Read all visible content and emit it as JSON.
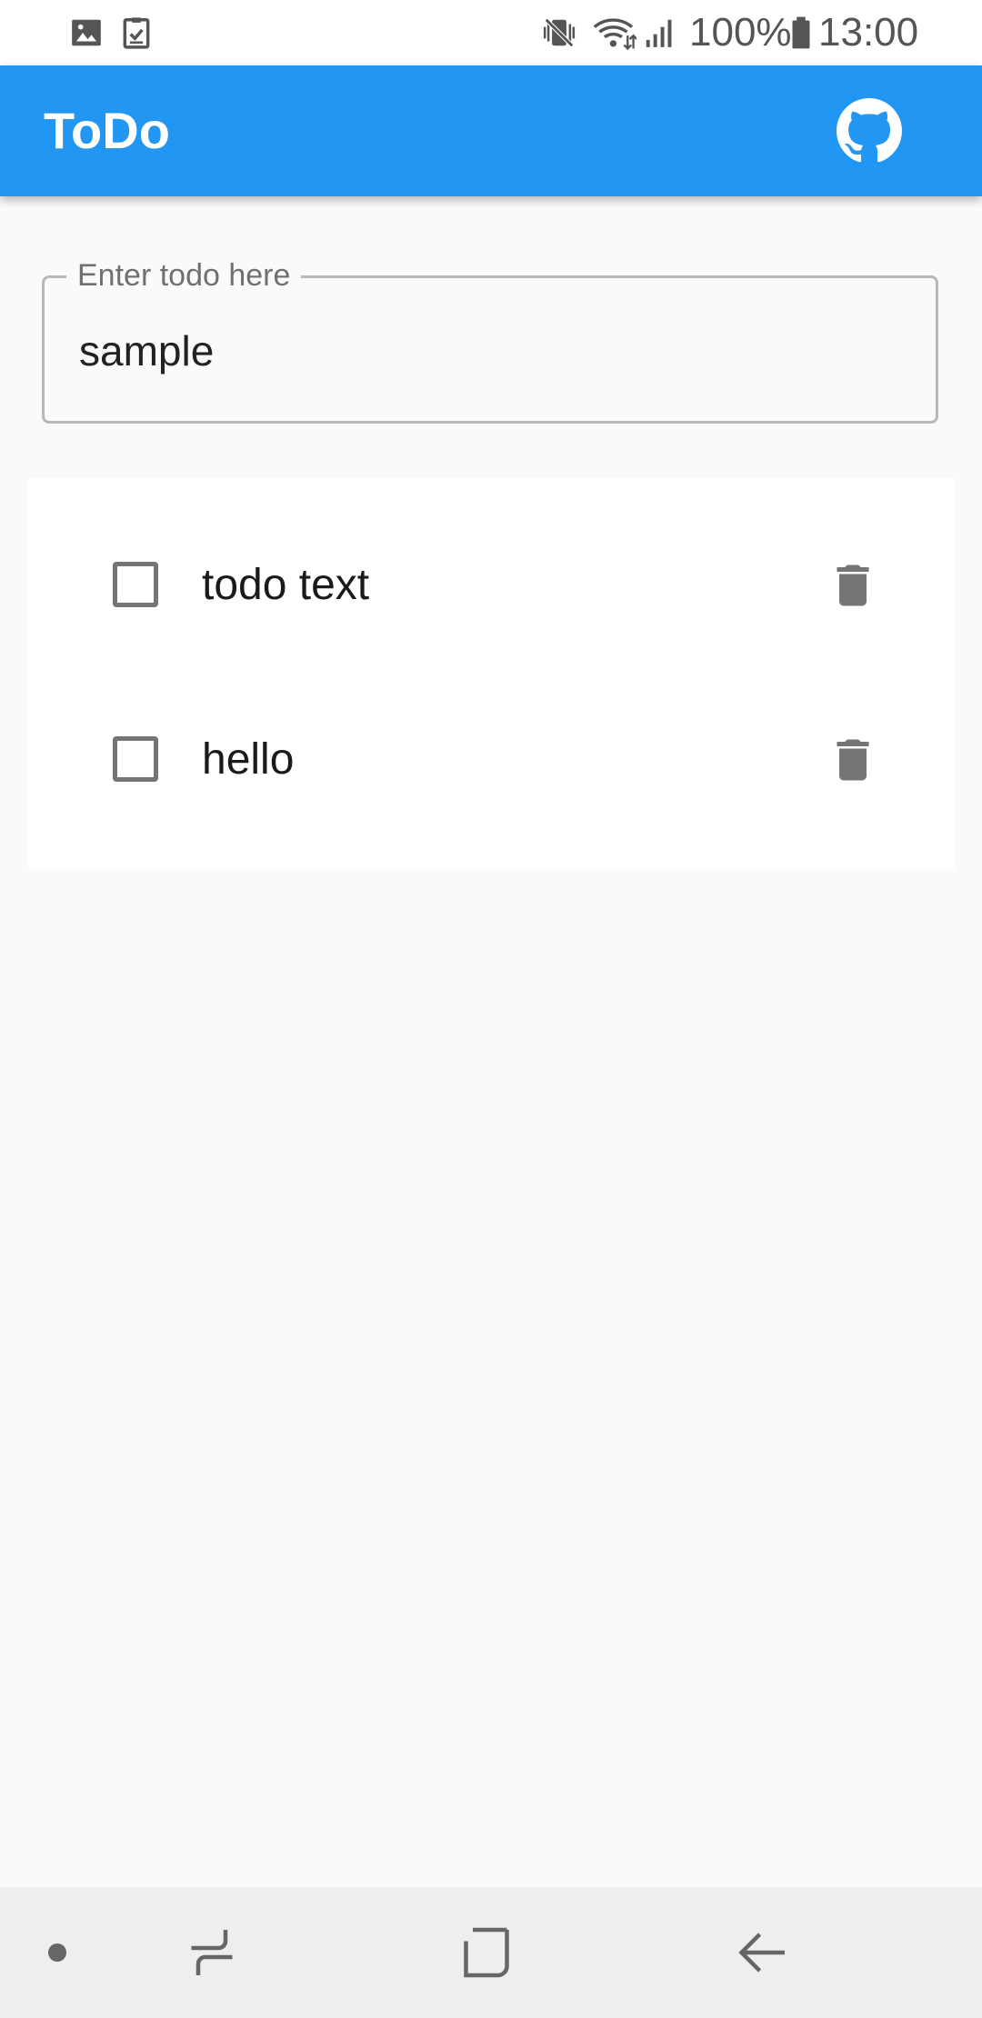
{
  "status_bar": {
    "left_icons": [
      "image-icon",
      "task-check-icon"
    ],
    "right_icons": [
      "mute-vibrate-icon",
      "wifi-icon",
      "signal-icon",
      "battery-icon"
    ],
    "battery": "100%",
    "time": "13:00"
  },
  "app_bar": {
    "title": "ToDo",
    "action_icon": "github-icon",
    "color": "#2196f3"
  },
  "todo_input": {
    "label": "Enter todo here",
    "value": "sample"
  },
  "todos": [
    {
      "text": "todo text",
      "checked": false,
      "delete_icon": "trash-icon"
    },
    {
      "text": "hello",
      "checked": false,
      "delete_icon": "trash-icon"
    }
  ],
  "nav_bar": {
    "buttons": [
      "dot-icon",
      "recents-icon",
      "home-icon",
      "back-icon"
    ]
  }
}
